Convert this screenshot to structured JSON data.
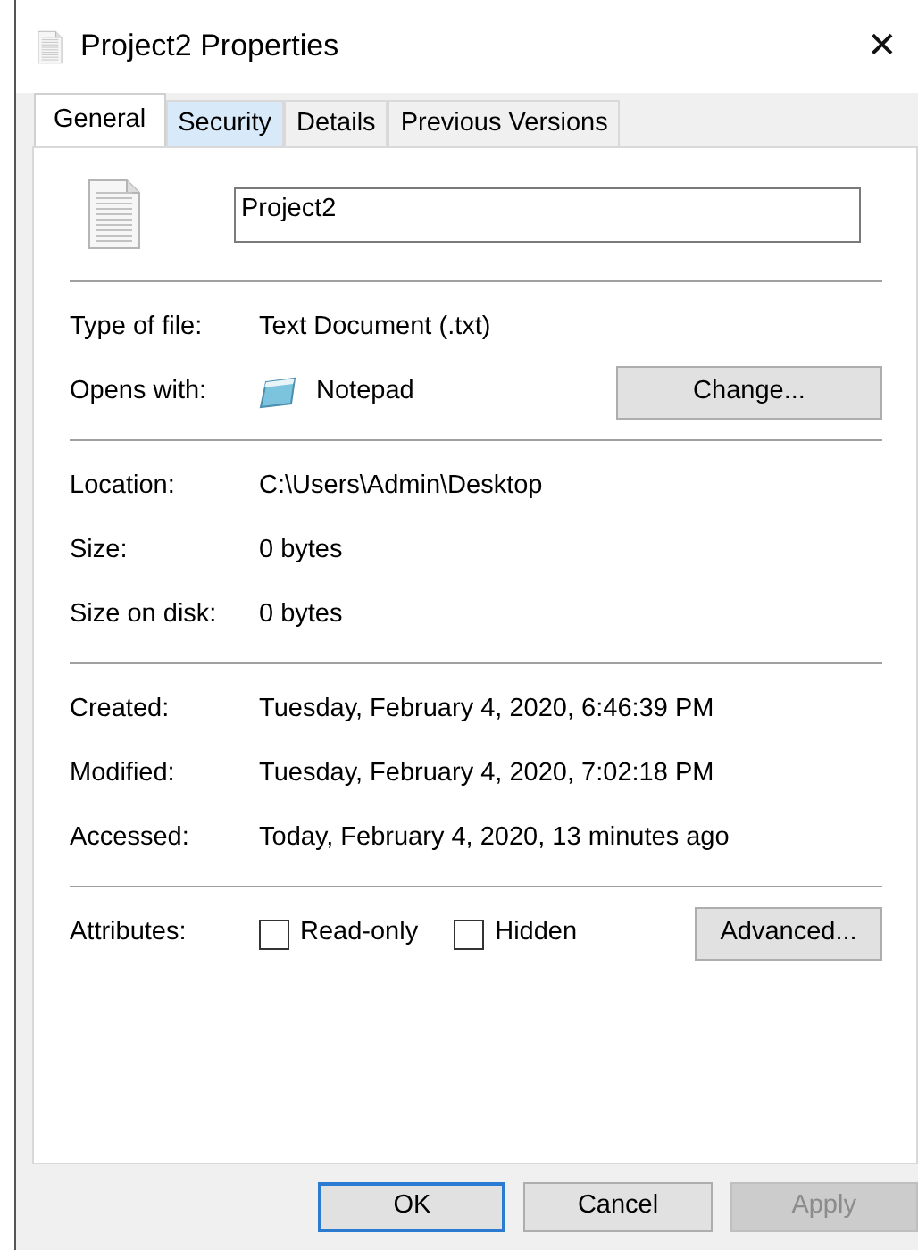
{
  "window": {
    "title": "Project2 Properties",
    "close": "✕"
  },
  "tabs": [
    {
      "label": "General",
      "selected": true,
      "hovered": false
    },
    {
      "label": "Security",
      "selected": false,
      "hovered": true
    },
    {
      "label": "Details",
      "selected": false,
      "hovered": false
    },
    {
      "label": "Previous Versions",
      "selected": false,
      "hovered": false
    }
  ],
  "name_field": {
    "value": "Project2"
  },
  "sections": [
    [
      {
        "kind": "text",
        "label": "Type of file:",
        "value": "Text Document (.txt)"
      },
      {
        "kind": "app",
        "label": "Opens with:",
        "value": "Notepad",
        "button": "Change..."
      }
    ],
    [
      {
        "kind": "text",
        "label": "Location:",
        "value": "C:\\Users\\Admin\\Desktop"
      },
      {
        "kind": "text",
        "label": "Size:",
        "value": "0 bytes"
      },
      {
        "kind": "text",
        "label": "Size on disk:",
        "value": "0 bytes"
      }
    ],
    [
      {
        "kind": "text",
        "label": "Created:",
        "value": "Tuesday, February 4, 2020, 6:46:39 PM"
      },
      {
        "kind": "text",
        "label": "Modified:",
        "value": "Tuesday, February 4, 2020, 7:02:18 PM"
      },
      {
        "kind": "text",
        "label": "Accessed:",
        "value": "Today, February 4, 2020, 13 minutes ago"
      }
    ],
    [
      {
        "kind": "attributes",
        "label": "Attributes:",
        "options": [
          {
            "label": "Read-only",
            "checked": false
          },
          {
            "label": "Hidden",
            "checked": false
          }
        ],
        "button": "Advanced..."
      }
    ]
  ],
  "buttons": [
    {
      "label": "OK",
      "default": true,
      "disabled": false
    },
    {
      "label": "Cancel",
      "default": false,
      "disabled": false
    },
    {
      "label": "Apply",
      "default": false,
      "disabled": true
    }
  ]
}
